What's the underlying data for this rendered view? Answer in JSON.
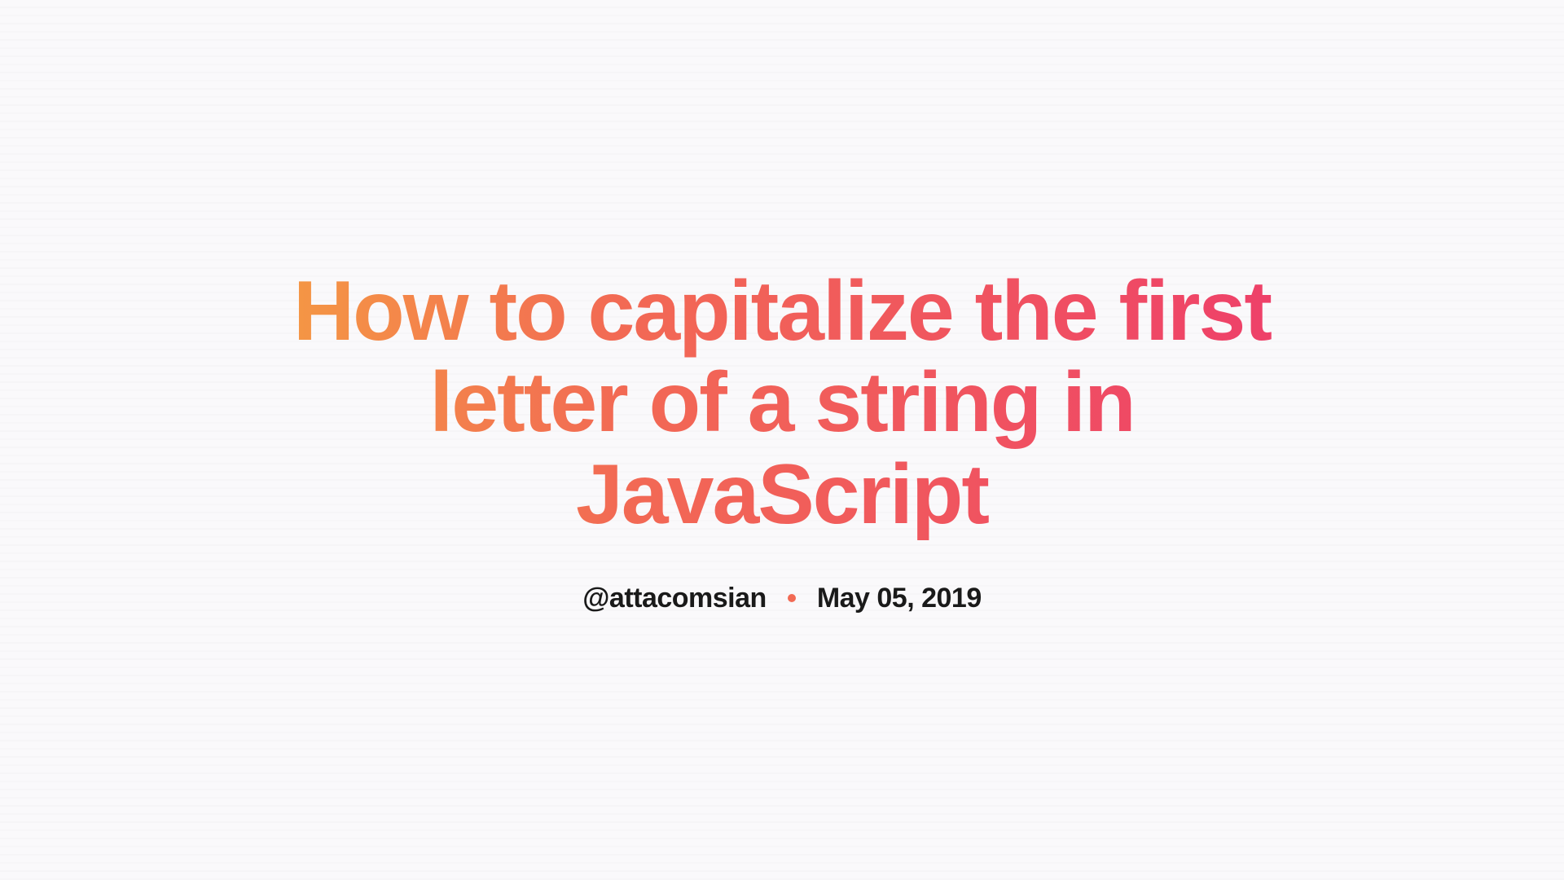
{
  "post": {
    "title": "How to capitalize the first letter of a string in JavaScript",
    "author_handle": "@attacomsian",
    "date": "May 05, 2019"
  }
}
